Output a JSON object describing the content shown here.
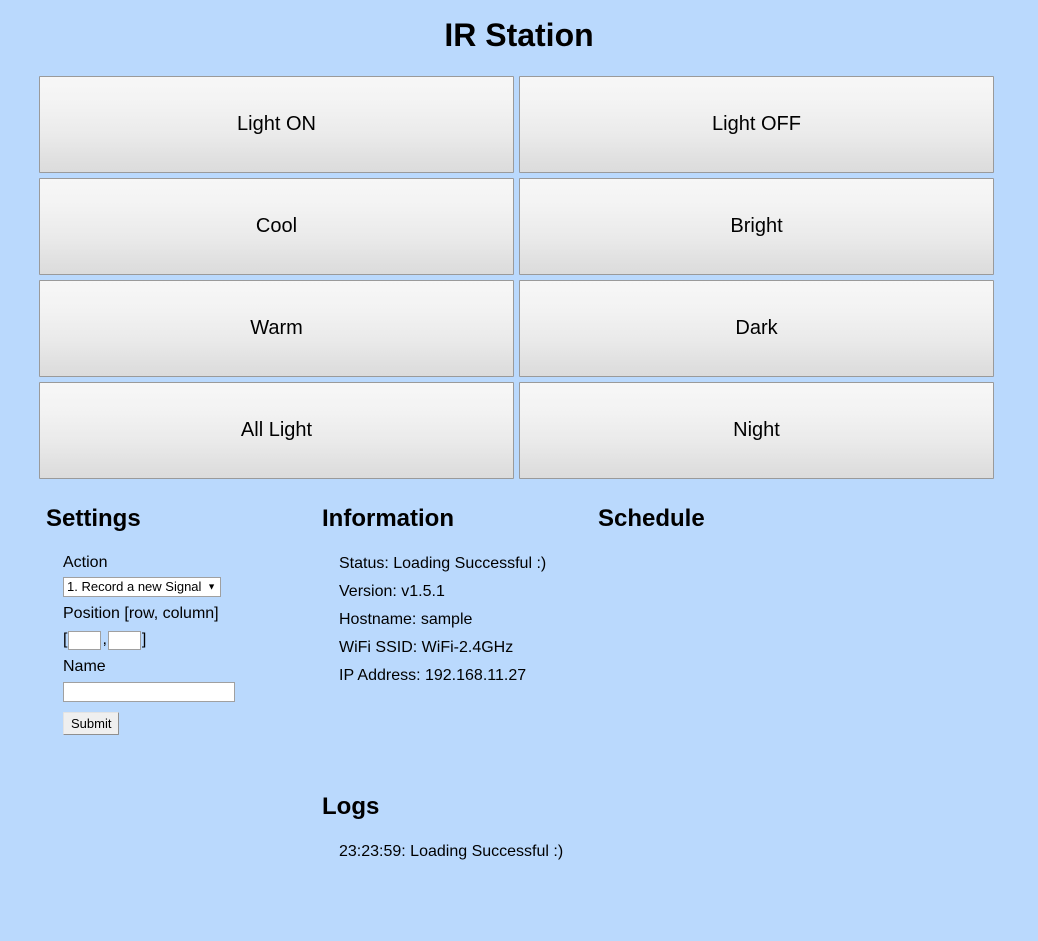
{
  "header": {
    "title": "IR Station"
  },
  "buttons": [
    {
      "label": "Light ON"
    },
    {
      "label": "Light OFF"
    },
    {
      "label": "Cool"
    },
    {
      "label": "Bright"
    },
    {
      "label": "Warm"
    },
    {
      "label": "Dark"
    },
    {
      "label": "All Light"
    },
    {
      "label": "Night"
    }
  ],
  "settings": {
    "heading": "Settings",
    "action_label": "Action",
    "action_selected": "1. Record a new Signal",
    "action_arrow": "▼",
    "position_label": "Position [row, column]",
    "bracket_open": "[",
    "bracket_comma": ",",
    "bracket_close": "]",
    "position_row_value": "",
    "position_col_value": "",
    "name_label": "Name",
    "name_value": "",
    "submit_label": "Submit"
  },
  "information": {
    "heading": "Information",
    "lines": [
      "Status: Loading Successful :)",
      "Version: v1.5.1",
      "Hostname: sample",
      "WiFi SSID: WiFi-2.4GHz",
      "IP Address: 192.168.11.27"
    ]
  },
  "schedule": {
    "heading": "Schedule",
    "items": []
  },
  "logs": {
    "heading": "Logs",
    "entries": [
      "23:23:59: Loading Successful :)"
    ]
  },
  "colors": {
    "background": "#bad9fd",
    "button_border": "#9a9a9a",
    "text": "#000000",
    "input_background": "#ffffff"
  }
}
